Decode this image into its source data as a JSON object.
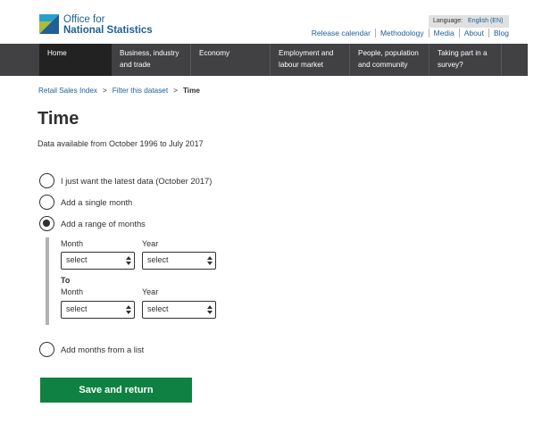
{
  "header": {
    "logo": {
      "line1": "Office for",
      "line2": "National Statistics"
    },
    "language": {
      "label": "Language:",
      "current": "English (EN)"
    },
    "util_links": [
      "Release calendar",
      "Methodology",
      "Media",
      "About",
      "Blog"
    ]
  },
  "nav": {
    "items": [
      {
        "line1": "Home",
        "line2": ""
      },
      {
        "line1": "Business, industry",
        "line2": "and trade"
      },
      {
        "line1": "Economy",
        "line2": ""
      },
      {
        "line1": "Employment and",
        "line2": "labour market"
      },
      {
        "line1": "People, population",
        "line2": "and community"
      },
      {
        "line1": "Taking part in a",
        "line2": "survey?"
      }
    ]
  },
  "breadcrumb": {
    "item1": "Retail Sales Index",
    "item2": "Filter this dataset",
    "current": "Time",
    "separator": ">"
  },
  "page": {
    "title": "Time",
    "availability": "Data available from October 1996 to July 2017"
  },
  "options": {
    "latest": "I just want the latest data (October 2017)",
    "single": "Add a single month",
    "range": "Add a range of months",
    "list": "Add months from a list",
    "selected": "range"
  },
  "range": {
    "from": {
      "month_label": "Month",
      "year_label": "Year",
      "month_value": "select",
      "year_value": "select"
    },
    "to_label": "To",
    "to": {
      "month_label": "Month",
      "year_label": "Year",
      "month_value": "select",
      "year_value": "select"
    }
  },
  "actions": {
    "save_label": "Save and return"
  },
  "colors": {
    "brand_blue": "#206095",
    "nav_bg": "#414042",
    "nav_active": "#222222",
    "button_green": "#0f8243"
  }
}
